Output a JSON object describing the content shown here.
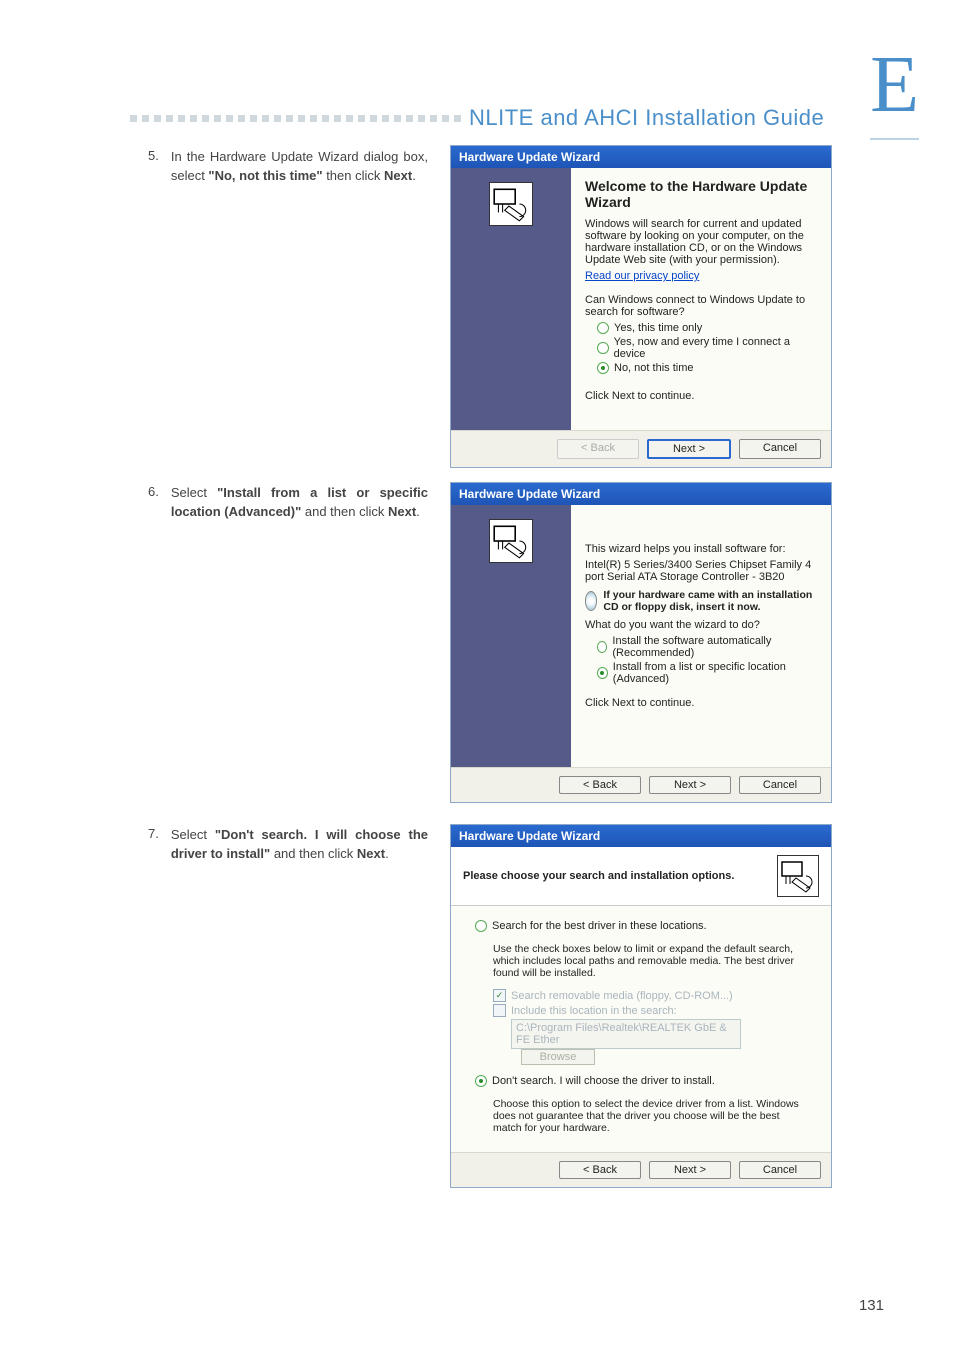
{
  "header": {
    "appendix_letter": "E",
    "guide_title": "NLITE and AHCI Installation Guide"
  },
  "steps": {
    "s5": {
      "num": "5.",
      "text_pre": "In the Hardware Update Wizard dialog box, select ",
      "bold": "\"No, not this time\"",
      "text_mid": " then click ",
      "bold2": "Next",
      "text_post": "."
    },
    "s6": {
      "num": "6.",
      "text_pre": "Select ",
      "bold": "\"Install from a list or specific location (Advanced)\"",
      "text_mid": " and then click ",
      "bold2": "Next",
      "text_post": "."
    },
    "s7": {
      "num": "7.",
      "text_pre": "Select ",
      "bold": "\"Don't search. I will choose the driver to install\"",
      "text_mid": " and then click ",
      "bold2": "Next",
      "text_post": "."
    }
  },
  "wiz1": {
    "title": "Hardware Update Wizard",
    "h": "Welcome to the Hardware Update Wizard",
    "p1": "Windows will search for current and updated software by looking on your computer, on the hardware installation CD, or on the Windows Update Web site (with your permission).",
    "link": "Read our privacy policy",
    "p2": "Can Windows connect to Windows Update to search for software?",
    "r1": "Yes, this time only",
    "r2": "Yes, now and every time I connect a device",
    "r3": "No, not this time",
    "p3": "Click Next to continue.",
    "back": "< Back",
    "next": "Next >",
    "cancel": "Cancel"
  },
  "wiz2": {
    "title": "Hardware Update Wizard",
    "p1": "This wizard helps you install software for:",
    "device": "Intel(R) 5 Series/3400 Series Chipset Family 4 port Serial ATA Storage Controller - 3B20",
    "cd_bold": "If your hardware came with an installation CD or floppy disk, insert it now.",
    "p2": "What do you want the wizard to do?",
    "r1": "Install the software automatically (Recommended)",
    "r2": "Install from a list or specific location (Advanced)",
    "p3": "Click Next to continue.",
    "back": "< Back",
    "next": "Next >",
    "cancel": "Cancel"
  },
  "wiz3": {
    "title": "Hardware Update Wizard",
    "h": "Please choose your search and installation options.",
    "r1": "Search for the best driver in these locations.",
    "r1_desc": "Use the check boxes below to limit or expand the default search, which includes local paths and removable media. The best driver found will be installed.",
    "c1": "Search removable media (floppy, CD-ROM...)",
    "c2": "Include this location in the search:",
    "path": "C:\\Program Files\\Realtek\\REALTEK GbE & FE Ether",
    "browse": "Browse",
    "r2": "Don't search. I will choose the driver to install.",
    "r2_desc": "Choose this option to select the device driver from a list.  Windows does not guarantee that the driver you choose will be the best match for your hardware.",
    "back": "< Back",
    "next": "Next >",
    "cancel": "Cancel"
  },
  "page_number": "131"
}
